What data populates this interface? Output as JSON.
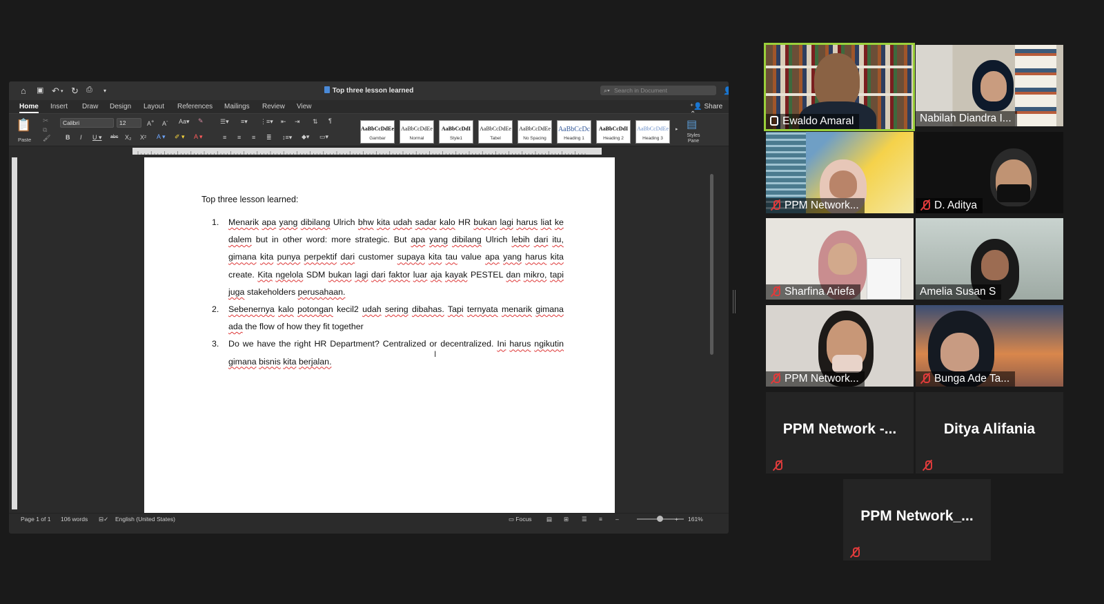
{
  "word": {
    "title": "Top three lesson learned",
    "search_placeholder": "Search in Document",
    "tabs": [
      "Home",
      "Insert",
      "Draw",
      "Design",
      "Layout",
      "References",
      "Mailings",
      "Review",
      "View"
    ],
    "share_label": "Share",
    "ribbon": {
      "paste_label": "Paste",
      "font_name": "Calibri",
      "font_size": "12",
      "styles": [
        {
          "preview": "AaBbCcDdEe",
          "name": "Gambar"
        },
        {
          "preview": "AaBbCcDdEe",
          "name": "Normal"
        },
        {
          "preview": "AaBbCcDdI",
          "name": "Style1"
        },
        {
          "preview": "AaBbCcDdEe",
          "name": "Tabel"
        },
        {
          "preview": "AaBbCcDdEe",
          "name": "No Spacing"
        },
        {
          "preview": "AaBbCcDc",
          "name": "Heading 1"
        },
        {
          "preview": "AaBbCcDdI",
          "name": "Heading 2"
        },
        {
          "preview": "AaBbCcDdEe",
          "name": "Heading 3"
        }
      ],
      "styles_pane_label": "Styles Pane"
    },
    "document": {
      "heading": "Top three lesson learned:",
      "items": [
        {
          "num": "1.",
          "text": "Menarik apa yang dibilang Ulrich bhw kita udah sadar kalo HR bukan lagi harus liat ke dalem but in other word: more strategic. But apa yang dibilang Ulrich lebih dari itu, gimana kita punya perpektif dari customer supaya kita tau value apa yang harus kita create. Kita ngelola SDM bukan lagi dari faktor luar aja kayak PESTEL dan mikro, tapi juga stakeholders perusahaan."
        },
        {
          "num": "2.",
          "text": "Sebenernya kalo potongan kecil2 udah sering dibahas. Tapi ternyata menarik gimana ada the flow of how they fit together"
        },
        {
          "num": "3.",
          "text": "Do we have the right HR Department? Centralized or decentralized. Ini harus ngikutin gimana bisnis kita berjalan."
        }
      ]
    },
    "status": {
      "page": "Page 1 of 1",
      "words": "106 words",
      "language": "English (United States)",
      "focus": "Focus",
      "zoom": "161%"
    }
  },
  "participants": [
    {
      "name": "Ewaldo Amaral",
      "muted": false,
      "video": true
    },
    {
      "name": "Nabilah Diandra I...",
      "muted": false,
      "video": true
    },
    {
      "name": "PPM Network...",
      "muted": true,
      "video": true
    },
    {
      "name": "D. Aditya",
      "muted": true,
      "video": true
    },
    {
      "name": "Sharfina Ariefa",
      "muted": true,
      "video": true
    },
    {
      "name": "Amelia Susan S",
      "muted": false,
      "video": true
    },
    {
      "name": "PPM Network...",
      "muted": true,
      "video": true
    },
    {
      "name": "Bunga Ade Ta...",
      "muted": true,
      "video": true
    },
    {
      "name": "PPM Network -...",
      "muted": true,
      "video": false
    },
    {
      "name": "Ditya Alifania",
      "muted": true,
      "video": false
    },
    {
      "name": "PPM Network_...",
      "muted": true,
      "video": false
    }
  ]
}
